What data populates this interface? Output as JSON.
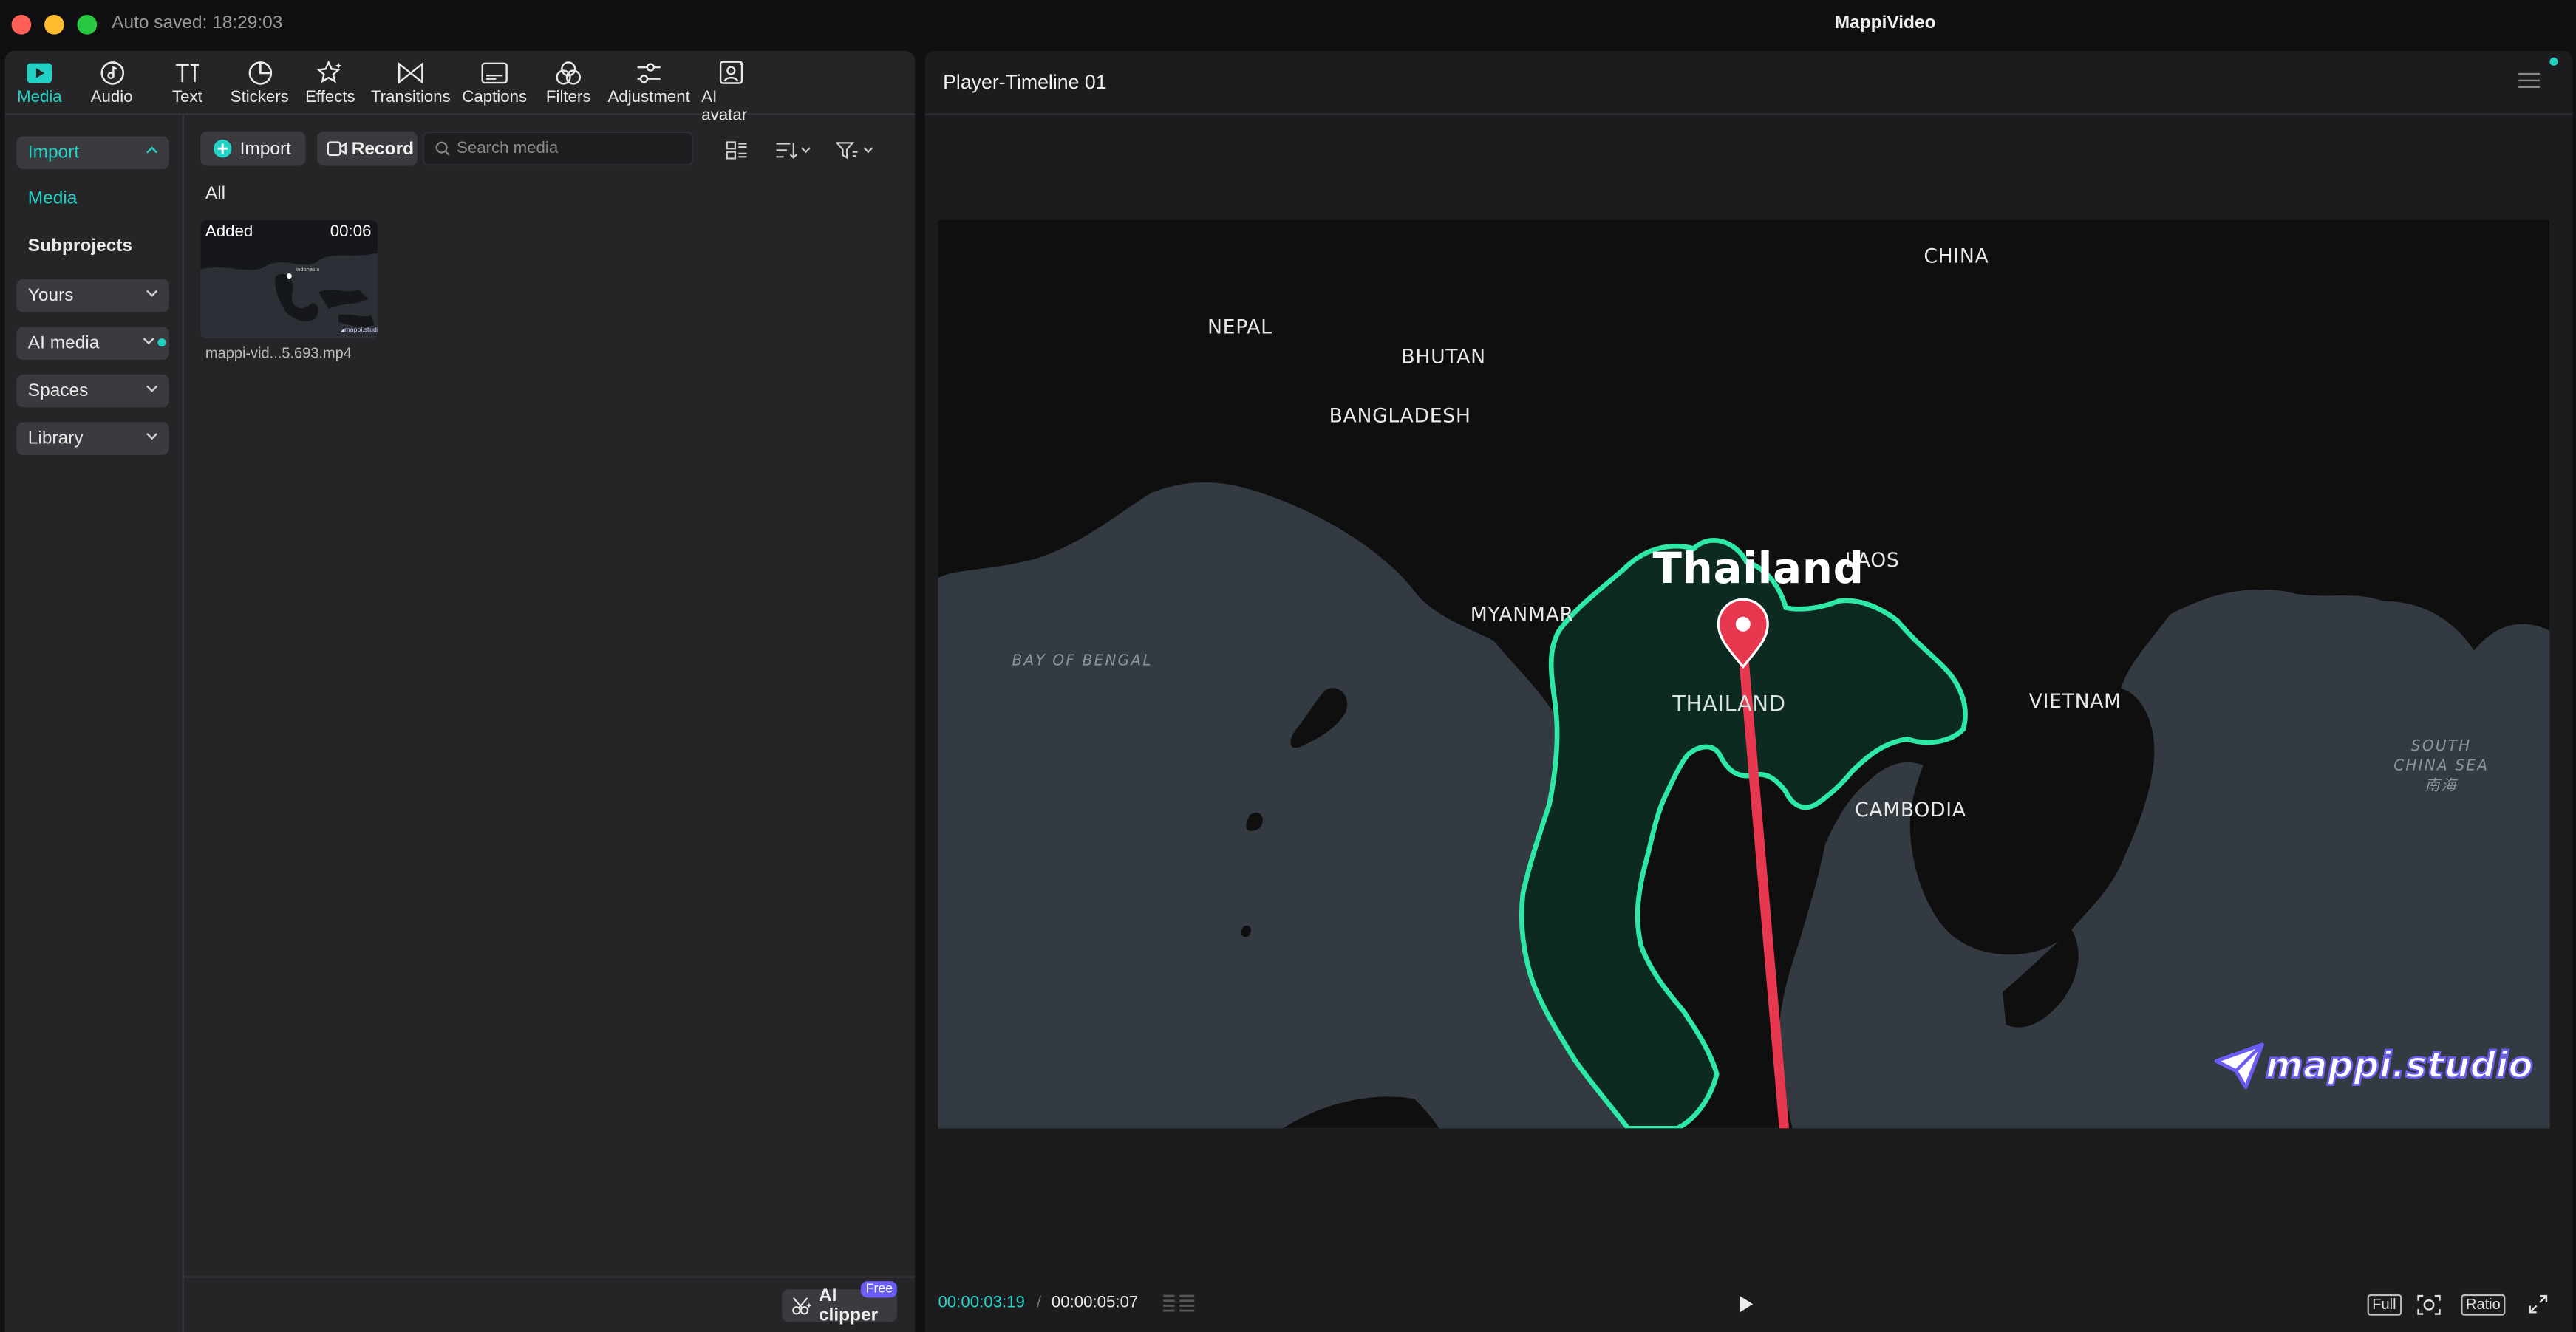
{
  "window": {
    "autosave_text": "Auto saved: 18:29:03",
    "app_title": "MappiVideo"
  },
  "toolbar": {
    "tools": [
      {
        "label": "Media",
        "icon": "media-icon",
        "active": true
      },
      {
        "label": "Audio",
        "icon": "audio-icon"
      },
      {
        "label": "Text",
        "icon": "text-icon"
      },
      {
        "label": "Stickers",
        "icon": "stickers-icon"
      },
      {
        "label": "Effects",
        "icon": "effects-icon"
      },
      {
        "label": "Transitions",
        "icon": "transitions-icon"
      },
      {
        "label": "Captions",
        "icon": "captions-icon"
      },
      {
        "label": "Filters",
        "icon": "filters-icon"
      },
      {
        "label": "Adjustment",
        "icon": "adjustment-icon"
      },
      {
        "label": "AI avatar",
        "icon": "ai-avatar-icon"
      }
    ]
  },
  "sidebar": {
    "import": "Import",
    "media": "Media",
    "subprojects": "Subprojects",
    "yours": "Yours",
    "ai_media": "AI media",
    "spaces": "Spaces",
    "library": "Library"
  },
  "media_panel": {
    "import_label": "Import",
    "record_label": "Record",
    "search_placeholder": "Search media",
    "filter_all": "All",
    "items": [
      {
        "badge": "Added",
        "duration": "00:06",
        "name": "mappi-vid...5.693.mp4"
      }
    ],
    "ai_clipper": "AI clipper",
    "free_badge": "Free"
  },
  "player": {
    "title": "Player-Timeline 01",
    "current_time": "00:00:03:19",
    "separator": "/",
    "total_time": "00:00:05:07",
    "full_label": "Full",
    "ratio_label": "Ratio"
  },
  "map": {
    "labels": {
      "china": "CHINA",
      "nepal": "NEPAL",
      "bhutan": "BHUTAN",
      "bangladesh": "BANGLADESH",
      "laos": "LAOS",
      "myanmar": "MYANMAR",
      "thailand_title": "Thailand",
      "thailand": "THAILAND",
      "vietnam": "VIETNAM",
      "cambodia": "CAMBODIA",
      "bay_of_bengal": "BAY OF BENGAL",
      "south_china_sea_1": "SOUTH",
      "south_china_sea_2": "CHINA SEA",
      "south_china_sea_3": "南海"
    },
    "brand": "mappi.studio",
    "colors": {
      "land": "#0f0f10",
      "water": "#343a41",
      "highlight_fill": "#0d2a22",
      "highlight_stroke": "#2ee8a6",
      "route": "#e8384f",
      "pin": "#e8384f"
    }
  },
  "colors": {
    "accent": "#22d3c5",
    "panel": "#252528",
    "badge_purple": "#6b5cf6"
  }
}
